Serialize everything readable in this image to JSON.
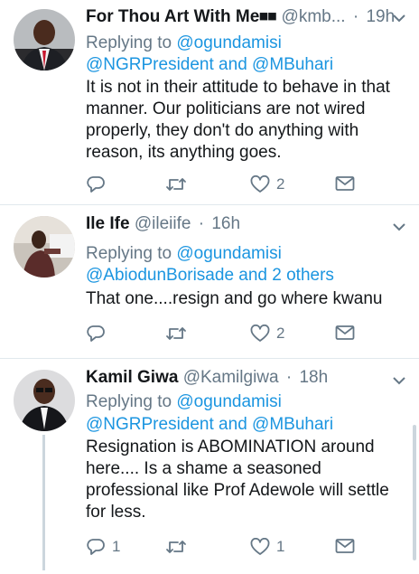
{
  "tweets": [
    {
      "name": "For Thou Art With Me⏹⏹",
      "handle": "@kmb...",
      "dot": "·",
      "time": "19h",
      "reply_prefix": "Replying to",
      "reply_line1": "@ogundamisi",
      "reply_line2": "@NGRPresident and @MBuhari",
      "text": "It is not in their attitude to behave in that manner. Our politicians are not wired properly, they don't do anything with reason, its anything goes.",
      "reply_count": "",
      "retweet_count": "",
      "like_count": "2"
    },
    {
      "name": "Ile Ife",
      "handle": "@ileiife",
      "dot": "·",
      "time": "16h",
      "reply_prefix": "Replying to",
      "reply_line1": "@ogundamisi",
      "reply_line2": "@AbiodunBorisade and 2 others",
      "text": "That one....resign and go where kwanu",
      "reply_count": "",
      "retweet_count": "",
      "like_count": "2"
    },
    {
      "name": "Kamil Giwa",
      "handle": "@Kamilgiwa",
      "dot": "·",
      "time": "18h",
      "reply_prefix": "Replying to",
      "reply_line1": "@ogundamisi",
      "reply_line2": "@NGRPresident and @MBuhari",
      "text": "Resignation is ABOMINATION around here.... Is a shame a seasoned professional like Prof Adewole will settle for less.",
      "reply_count": "1",
      "retweet_count": "",
      "like_count": "1"
    }
  ],
  "icons": {
    "reply": "reply-icon",
    "retweet": "retweet-icon",
    "like": "heart-icon",
    "dm": "envelope-icon",
    "more": "chevron-down-icon"
  },
  "colors": {
    "link": "#1b95e0",
    "secondary_text": "#657786",
    "divider": "#e1e8ed"
  }
}
